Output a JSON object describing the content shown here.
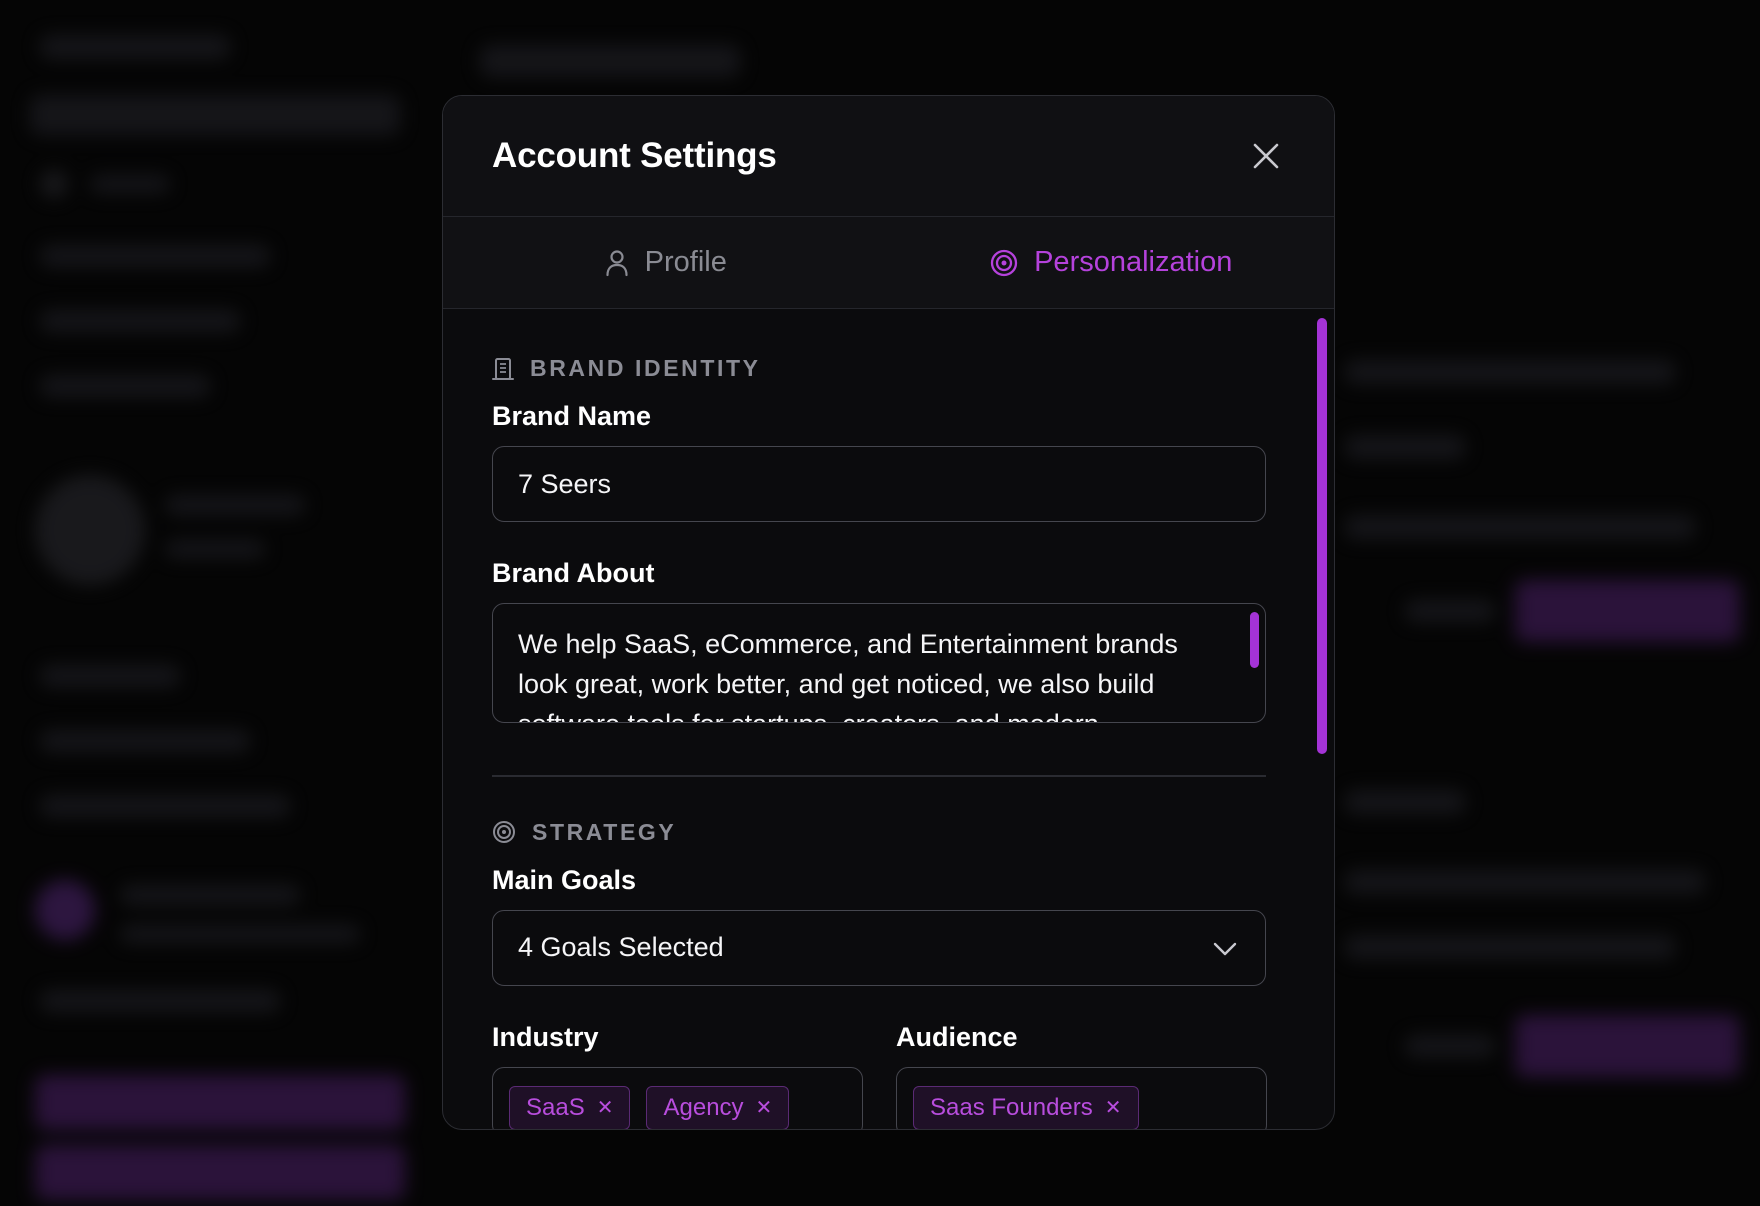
{
  "modal": {
    "title": "Account Settings"
  },
  "tabs": [
    {
      "label": "Profile",
      "icon": "user-icon",
      "active": false
    },
    {
      "label": "Personalization",
      "icon": "target-icon",
      "active": true
    }
  ],
  "brand_identity": {
    "heading": "BRAND IDENTITY",
    "brand_name_label": "Brand Name",
    "brand_name_value": "7 Seers",
    "brand_about_label": "Brand About",
    "brand_about_value": "We help SaaS, eCommerce, and Entertainment brands look great, work better, and get noticed, we also build software tools for startups, creators, and modern"
  },
  "strategy": {
    "heading": "STRATEGY",
    "main_goals_label": "Main Goals",
    "main_goals_value": "4 Goals Selected",
    "industry_label": "Industry",
    "industry_tags": [
      "SaaS",
      "Agency"
    ],
    "audience_label": "Audience",
    "audience_tags": [
      "Saas Founders"
    ]
  },
  "colors": {
    "accent": "#b542dc",
    "background": "#0b0b0d",
    "border": "#45464e"
  }
}
